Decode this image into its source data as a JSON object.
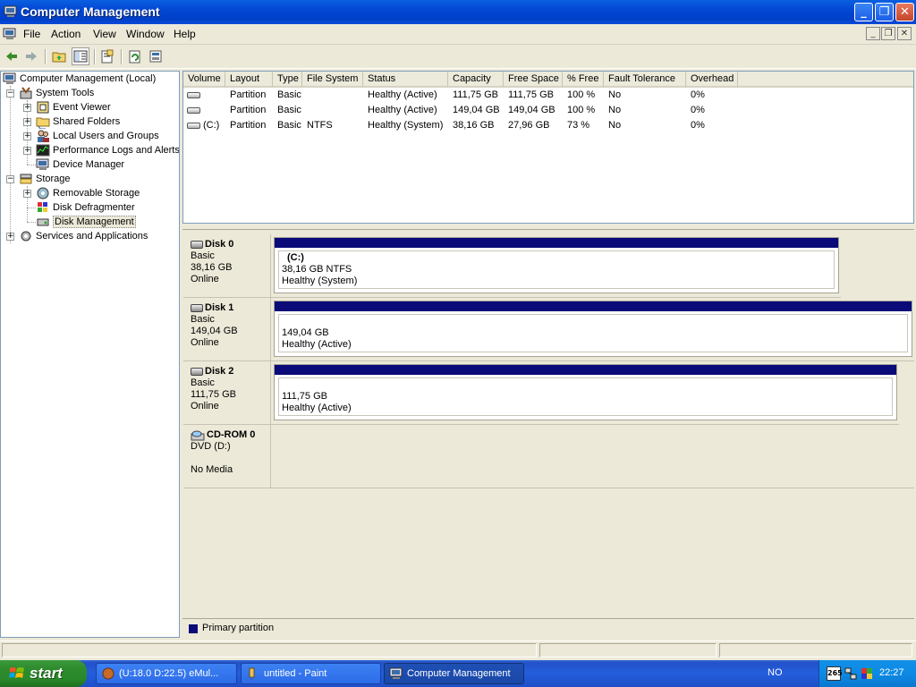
{
  "window": {
    "title": "Computer Management"
  },
  "menu": {
    "items": [
      "File",
      "Action",
      "View",
      "Window",
      "Help"
    ]
  },
  "tree": {
    "root": "Computer Management (Local)",
    "system_tools": "System Tools",
    "event_viewer": "Event Viewer",
    "shared_folders": "Shared Folders",
    "local_users": "Local Users and Groups",
    "perf_logs": "Performance Logs and Alerts",
    "device_manager": "Device Manager",
    "storage": "Storage",
    "removable_storage": "Removable Storage",
    "disk_defrag": "Disk Defragmenter",
    "disk_management": "Disk Management",
    "services": "Services and Applications"
  },
  "volumes": {
    "columns": [
      "Volume",
      "Layout",
      "Type",
      "File System",
      "Status",
      "Capacity",
      "Free Space",
      "% Free",
      "Fault Tolerance",
      "Overhead"
    ],
    "rows": [
      [
        "",
        "Partition",
        "Basic",
        "",
        "Healthy (Active)",
        "111,75 GB",
        "111,75 GB",
        "100 %",
        "No",
        "0%"
      ],
      [
        "",
        "Partition",
        "Basic",
        "",
        "Healthy (Active)",
        "149,04 GB",
        "149,04 GB",
        "100 %",
        "No",
        "0%"
      ],
      [
        "(C:)",
        "Partition",
        "Basic",
        "NTFS",
        "Healthy (System)",
        "38,16 GB",
        "27,96 GB",
        "73 %",
        "No",
        "0%"
      ]
    ]
  },
  "disks": [
    {
      "name": "Disk 0",
      "type": "Basic",
      "size": "38,16 GB",
      "status": "Online",
      "part_label": "(C:)",
      "part_size": "38,16 GB NTFS",
      "part_status": "Healthy (System)"
    },
    {
      "name": "Disk 1",
      "type": "Basic",
      "size": "149,04 GB",
      "status": "Online",
      "part_label": "",
      "part_size": "149,04 GB",
      "part_status": "Healthy (Active)"
    },
    {
      "name": "Disk 2",
      "type": "Basic",
      "size": "111,75 GB",
      "status": "Online",
      "part_label": "",
      "part_size": "111,75 GB",
      "part_status": "Healthy (Active)"
    }
  ],
  "cdrom": {
    "name": "CD-ROM 0",
    "drive": "DVD (D:)",
    "status": "No Media"
  },
  "legend": {
    "primary": "Primary partition",
    "color": "#0a0a78"
  },
  "taskbar": {
    "start": "start",
    "tasks": [
      "(U:18.0 D:22.5) eMul...",
      "untitled - Paint",
      "Computer Management"
    ],
    "lang": "NO",
    "tray_badge": "265",
    "clock": "22:27"
  }
}
